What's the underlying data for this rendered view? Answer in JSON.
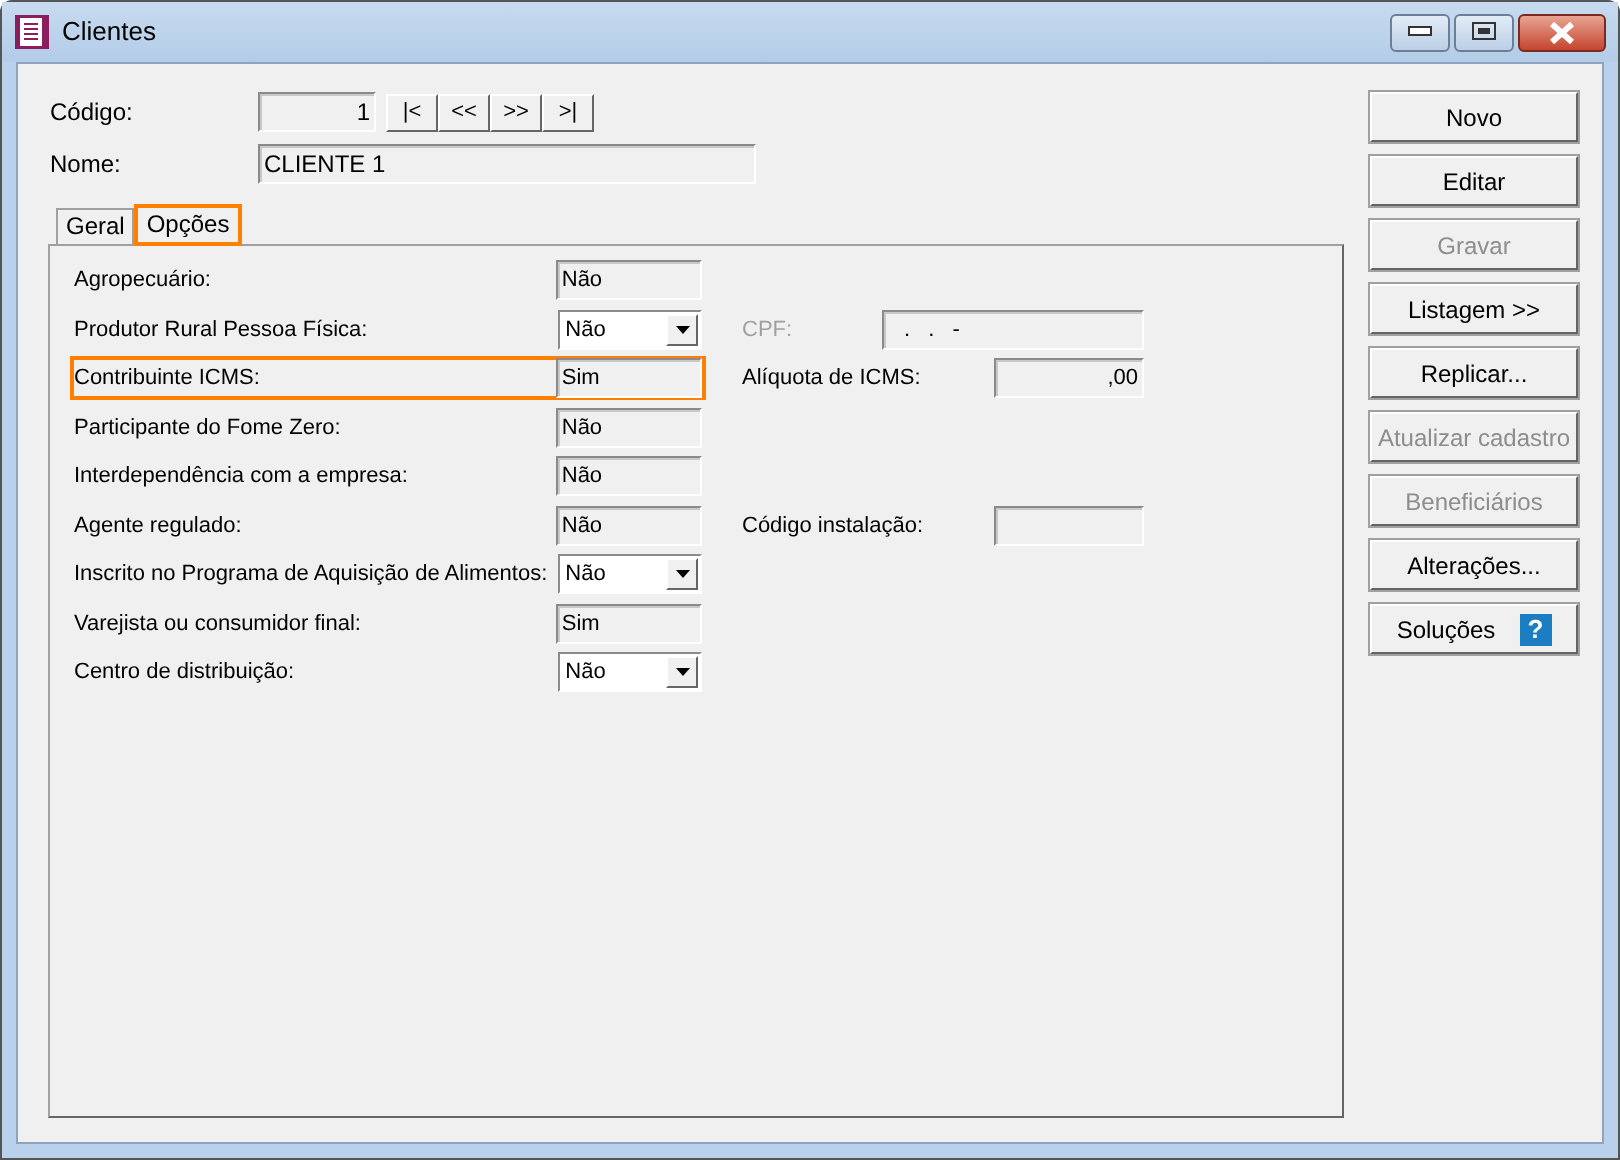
{
  "window": {
    "title": "Clientes"
  },
  "codigo": {
    "label": "Código:",
    "value": "1",
    "nav": [
      "|<",
      "<<",
      ">>",
      ">|"
    ]
  },
  "nome": {
    "label": "Nome:",
    "value": "CLIENTE 1"
  },
  "tabs": [
    {
      "label": "Geral",
      "selected": false
    },
    {
      "label": "Opções",
      "selected": true
    }
  ],
  "rows": [
    {
      "label": "Agropecuário:",
      "kind": "text",
      "value": "Não",
      "highlighted": false
    },
    {
      "label": "Produtor Rural Pessoa Física:",
      "kind": "select",
      "value": "Não",
      "highlighted": false,
      "side": {
        "label": "CPF:",
        "value": ". . -",
        "disabled": true,
        "kind": "text"
      }
    },
    {
      "label": "Contribuinte ICMS:",
      "kind": "text",
      "value": "Sim",
      "highlighted": true,
      "side": {
        "label": "Alíquota de ICMS:",
        "value": ",00",
        "disabled": false,
        "kind": "number"
      }
    },
    {
      "label": "Participante do Fome Zero:",
      "kind": "text",
      "value": "Não",
      "highlighted": false
    },
    {
      "label": "Interdependência com a empresa:",
      "kind": "text",
      "value": "Não",
      "highlighted": false
    },
    {
      "label": "Agente regulado:",
      "kind": "text",
      "value": "Não",
      "highlighted": false,
      "side": {
        "label": "Código instalação:",
        "disabled": false,
        "kind": "text"
      }
    },
    {
      "label": "Inscrito no Programa de Aquisição de Alimentos:",
      "kind": "select",
      "value": "Não",
      "highlighted": false
    },
    {
      "label": "Varejista ou consumidor final:",
      "kind": "text",
      "value": "Sim",
      "highlighted": false
    },
    {
      "label": "Centro de distribuição:",
      "kind": "select",
      "value": "Não",
      "highlighted": false
    }
  ],
  "buttons": [
    {
      "label": "Novo",
      "disabled": false
    },
    {
      "label": "Editar",
      "disabled": false
    },
    {
      "label": "Gravar",
      "disabled": true
    },
    {
      "label": "Listagem >>",
      "disabled": false
    },
    {
      "label": "Replicar...",
      "disabled": false
    },
    {
      "label": "Atualizar cadastro",
      "disabled": true
    },
    {
      "label": "Beneficiários",
      "disabled": true
    },
    {
      "label": "Alterações...",
      "disabled": false
    },
    {
      "label": "Soluções",
      "disabled": false,
      "icon": "?"
    }
  ]
}
